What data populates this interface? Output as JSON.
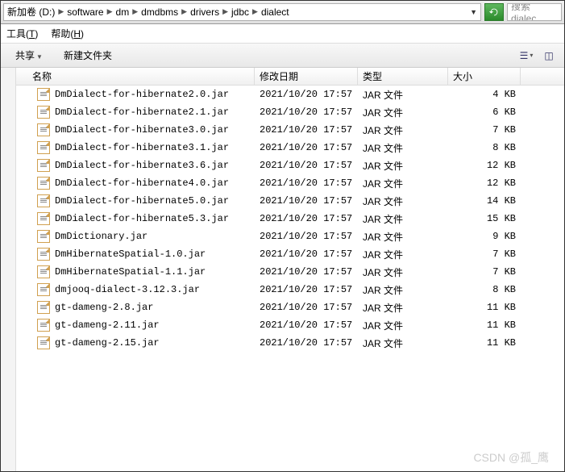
{
  "breadcrumb": {
    "root": "新加卷 (D:)",
    "parts": [
      "software",
      "dm",
      "dmdbms",
      "drivers",
      "jdbc",
      "dialect"
    ]
  },
  "search": {
    "placeholder": "搜索 dialec"
  },
  "menu": {
    "tools": "工具",
    "tools_u": "T",
    "help": "帮助",
    "help_u": "H"
  },
  "toolbar": {
    "share": "共享",
    "newfolder": "新建文件夹"
  },
  "columns": {
    "name": "名称",
    "date": "修改日期",
    "type": "类型",
    "size": "大小"
  },
  "files": [
    {
      "name": "DmDialect-for-hibernate2.0.jar",
      "date": "2021/10/20 17:57",
      "type": "JAR 文件",
      "size": "4 KB"
    },
    {
      "name": "DmDialect-for-hibernate2.1.jar",
      "date": "2021/10/20 17:57",
      "type": "JAR 文件",
      "size": "6 KB"
    },
    {
      "name": "DmDialect-for-hibernate3.0.jar",
      "date": "2021/10/20 17:57",
      "type": "JAR 文件",
      "size": "7 KB"
    },
    {
      "name": "DmDialect-for-hibernate3.1.jar",
      "date": "2021/10/20 17:57",
      "type": "JAR 文件",
      "size": "8 KB"
    },
    {
      "name": "DmDialect-for-hibernate3.6.jar",
      "date": "2021/10/20 17:57",
      "type": "JAR 文件",
      "size": "12 KB"
    },
    {
      "name": "DmDialect-for-hibernate4.0.jar",
      "date": "2021/10/20 17:57",
      "type": "JAR 文件",
      "size": "12 KB"
    },
    {
      "name": "DmDialect-for-hibernate5.0.jar",
      "date": "2021/10/20 17:57",
      "type": "JAR 文件",
      "size": "14 KB"
    },
    {
      "name": "DmDialect-for-hibernate5.3.jar",
      "date": "2021/10/20 17:57",
      "type": "JAR 文件",
      "size": "15 KB"
    },
    {
      "name": "DmDictionary.jar",
      "date": "2021/10/20 17:57",
      "type": "JAR 文件",
      "size": "9 KB"
    },
    {
      "name": "DmHibernateSpatial-1.0.jar",
      "date": "2021/10/20 17:57",
      "type": "JAR 文件",
      "size": "7 KB"
    },
    {
      "name": "DmHibernateSpatial-1.1.jar",
      "date": "2021/10/20 17:57",
      "type": "JAR 文件",
      "size": "7 KB"
    },
    {
      "name": "dmjooq-dialect-3.12.3.jar",
      "date": "2021/10/20 17:57",
      "type": "JAR 文件",
      "size": "8 KB"
    },
    {
      "name": "gt-dameng-2.8.jar",
      "date": "2021/10/20 17:57",
      "type": "JAR 文件",
      "size": "11 KB"
    },
    {
      "name": "gt-dameng-2.11.jar",
      "date": "2021/10/20 17:57",
      "type": "JAR 文件",
      "size": "11 KB"
    },
    {
      "name": "gt-dameng-2.15.jar",
      "date": "2021/10/20 17:57",
      "type": "JAR 文件",
      "size": "11 KB"
    }
  ],
  "watermark": "CSDN @孤_鹰"
}
